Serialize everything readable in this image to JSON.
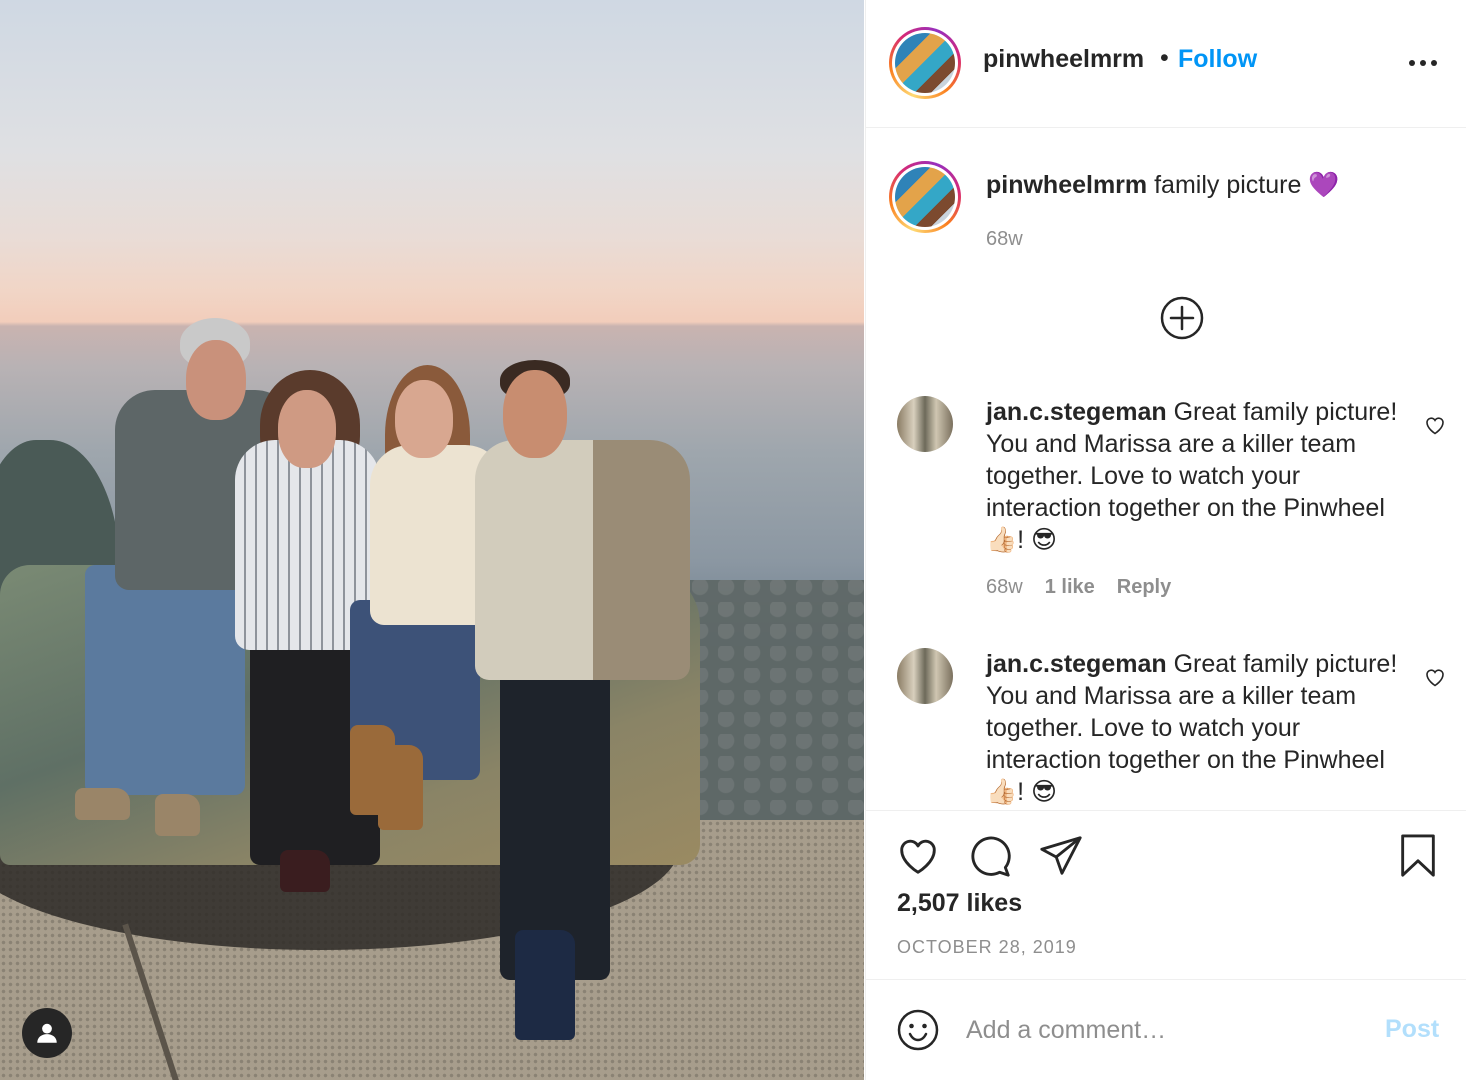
{
  "post": {
    "author": "pinwheelmrm",
    "follow_label": "Follow",
    "separator": "•",
    "caption_text": "family picture 💜",
    "caption_time": "68w"
  },
  "comments": [
    {
      "username": "jan.c.stegeman",
      "text": "Great family picture! You and Marissa are a killer team together. Love to watch your interaction together on the Pinwheel 👍🏻! 😎",
      "time": "68w",
      "likes": "1 like",
      "reply_label": "Reply"
    },
    {
      "username": "jan.c.stegeman",
      "text": "Great family picture! You and Marissa are a killer team together. Love to watch your interaction together on the Pinwheel 👍🏻! 😎"
    }
  ],
  "actions": {
    "likes_count": "2,507 likes",
    "date": "OCTOBER 28, 2019"
  },
  "add_comment": {
    "placeholder": "Add a comment…",
    "post_label": "Post"
  },
  "icons": {
    "like": "heart-icon",
    "comment": "comment-bubble-icon",
    "share": "paper-plane-icon",
    "save": "bookmark-icon",
    "more": "more-options-icon",
    "emoji": "emoji-smile-icon",
    "load_more": "plus-circle-icon",
    "user_tag": "user-tag-icon"
  },
  "colors": {
    "link": "#0095f6",
    "text": "#262626",
    "muted": "#8e8e8e",
    "post_disabled": "#b2dffc"
  }
}
